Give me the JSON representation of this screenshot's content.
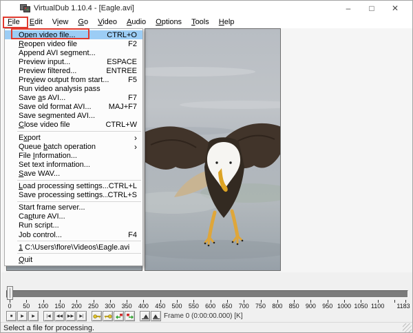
{
  "window": {
    "title": "VirtualDub 1.10.4 - [Eagle.avi]",
    "controls": {
      "minimize": "–",
      "maximize": "□",
      "close": "✕"
    }
  },
  "annotation": {
    "box_color": "#e0392e"
  },
  "menubar": {
    "items": [
      {
        "label": "File",
        "accel": 0
      },
      {
        "label": "Edit",
        "accel": 0
      },
      {
        "label": "View",
        "accel": 1
      },
      {
        "label": "Go",
        "accel": 0
      },
      {
        "label": "Video",
        "accel": 0
      },
      {
        "label": "Audio",
        "accel": 0
      },
      {
        "label": "Options",
        "accel": 0
      },
      {
        "label": "Tools",
        "accel": 0
      },
      {
        "label": "Help",
        "accel": 0
      }
    ]
  },
  "file_menu": {
    "highlight_color": "#9ccdf5",
    "items": [
      {
        "label": "Open video file...",
        "accel": 0,
        "shortcut": "CTRL+O",
        "highlighted": true,
        "annotated": true
      },
      {
        "label": "Reopen video file",
        "accel": 0,
        "shortcut": "F2"
      },
      {
        "label": "Append AVI segment..."
      },
      {
        "label": "Preview input...",
        "shortcut": "ESPACE"
      },
      {
        "label": "Preview filtered...",
        "shortcut": "ENTREE"
      },
      {
        "label": "Preview output from start...",
        "accel": 3,
        "shortcut": "F5"
      },
      {
        "label": "Run video analysis pass"
      },
      {
        "label": "Save as AVI...",
        "accel": 5,
        "shortcut": "F7"
      },
      {
        "label": "Save old format AVI...",
        "shortcut": "MAJ+F7"
      },
      {
        "label": "Save segmented AVI..."
      },
      {
        "label": "Close video file",
        "accel": 0,
        "shortcut": "CTRL+W"
      },
      {
        "separator": true
      },
      {
        "label": "Export",
        "accel": 1,
        "submenu": true
      },
      {
        "label": "Queue batch operation",
        "accel": 6,
        "submenu": true
      },
      {
        "label": "File Information...",
        "accel": 5
      },
      {
        "label": "Set text information..."
      },
      {
        "label": "Save WAV...",
        "accel": 0
      },
      {
        "separator": true
      },
      {
        "label": "Load processing settings...",
        "accel": 0,
        "shortcut": "CTRL+L"
      },
      {
        "label": "Save processing settings...",
        "shortcut": "CTRL+S"
      },
      {
        "separator": true
      },
      {
        "label": "Start frame server..."
      },
      {
        "label": "Capture AVI...",
        "accel": 2
      },
      {
        "label": "Run script..."
      },
      {
        "label": "Job control...",
        "shortcut": "F4"
      },
      {
        "separator": true
      },
      {
        "label": "1 C:\\Users\\flore\\Videos\\Eagle.avi",
        "accel": 0
      },
      {
        "separator": true
      },
      {
        "label": "Quit",
        "accel": 0
      }
    ]
  },
  "video_frame": {
    "colors": {
      "water-top": "#b8bdc3",
      "water-mid": "#b0b6bd",
      "water-low": "#97a0a8",
      "wing": "#41342a",
      "wing-dark": "#2b2119",
      "body": "#332a21",
      "head": "#f6f5f2",
      "beak": "#dda424",
      "tail": "#c8b492",
      "feet": "#dfa63a"
    }
  },
  "timeline": {
    "total_frames": 1183,
    "tick_labels": [
      0,
      50,
      100,
      150,
      200,
      250,
      300,
      350,
      400,
      450,
      500,
      550,
      600,
      650,
      700,
      750,
      800,
      850,
      900,
      950,
      1000,
      1050,
      1100,
      1183
    ],
    "unlabeled_tick": 1150
  },
  "transport": {
    "frame_label": "Frame 0 (0:00:00.000) [K]",
    "icon_colors": {
      "glyph": "#333333",
      "key": "#e3c62c",
      "key-dark": "#8a731a",
      "scene-green": "#2ba32b",
      "scene-red": "#d03030"
    },
    "buttons": [
      {
        "name": "stop",
        "glyph": "■",
        "group": 0
      },
      {
        "name": "play-input",
        "glyph": "▶",
        "group": 0
      },
      {
        "name": "play-output",
        "glyph": "▶",
        "group": 0
      },
      {
        "name": "go-start",
        "glyph": "|◀",
        "group": 1
      },
      {
        "name": "step-backward",
        "glyph": "◀◀",
        "group": 1
      },
      {
        "name": "step-forward",
        "glyph": "▶▶",
        "group": 1
      },
      {
        "name": "go-end",
        "glyph": "▶|",
        "group": 1
      },
      {
        "name": "prev-keyframe",
        "svg": "key-left",
        "group": 2
      },
      {
        "name": "next-keyframe",
        "svg": "key-right",
        "group": 2
      },
      {
        "name": "scene-reverse",
        "svg": "scene-left",
        "group": 2
      },
      {
        "name": "scene-forward",
        "svg": "scene-right",
        "group": 2
      },
      {
        "name": "mark-in",
        "svg": "mark-in",
        "group": 3
      },
      {
        "name": "mark-out",
        "svg": "mark-out",
        "group": 3
      }
    ]
  },
  "statusbar": {
    "text": "Select a file for processing."
  }
}
